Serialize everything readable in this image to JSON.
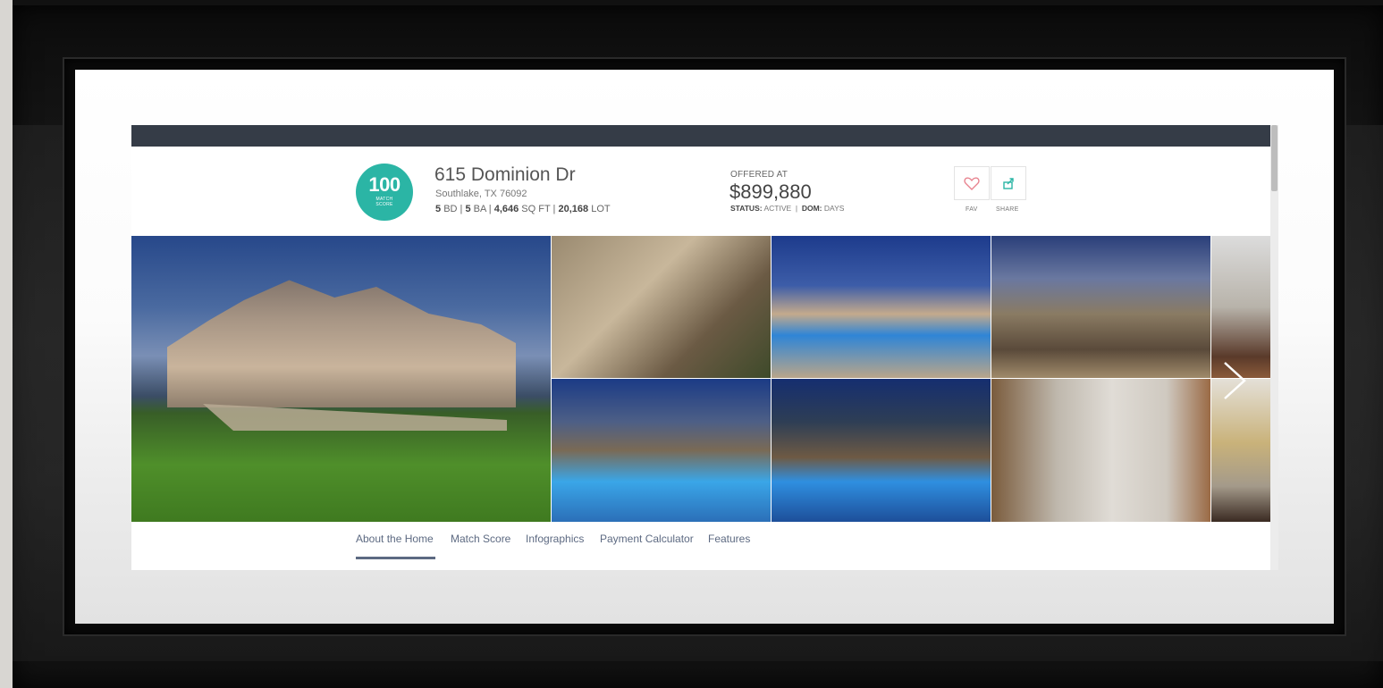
{
  "listing": {
    "match_score": "100",
    "match_score_label_1": "MATCH",
    "match_score_label_2": "SCORE",
    "address": "615 Dominion Dr",
    "city_state_zip": "Southlake, TX 76092",
    "beds": "5",
    "beds_unit": "BD",
    "baths": "5",
    "baths_unit": "BA",
    "sqft": "4,646",
    "sqft_unit": "SQ FT",
    "lot": "20,168",
    "lot_unit": "LOT",
    "offered_label": "OFFERED AT",
    "price": "$899,880",
    "status_label": "STATUS:",
    "status_value": "ACTIVE",
    "dom_label": "DOM:",
    "dom_value": "DAYS"
  },
  "actions": {
    "fav_label": "FAV",
    "share_label": "SHARE"
  },
  "tabs": [
    {
      "label": "About the Home"
    },
    {
      "label": "Match Score"
    },
    {
      "label": "Infographics"
    },
    {
      "label": "Payment Calculator"
    },
    {
      "label": "Features"
    }
  ],
  "colors": {
    "accent_teal": "#2bb5a5",
    "topbar": "#353c47",
    "tab_text": "#5d6a82",
    "fav_heart": "#e8838f",
    "share_icon": "#2bb5a5"
  },
  "icons": {
    "fav": "heart-outline-icon",
    "share": "share-box-icon",
    "next": "chevron-right-icon"
  }
}
